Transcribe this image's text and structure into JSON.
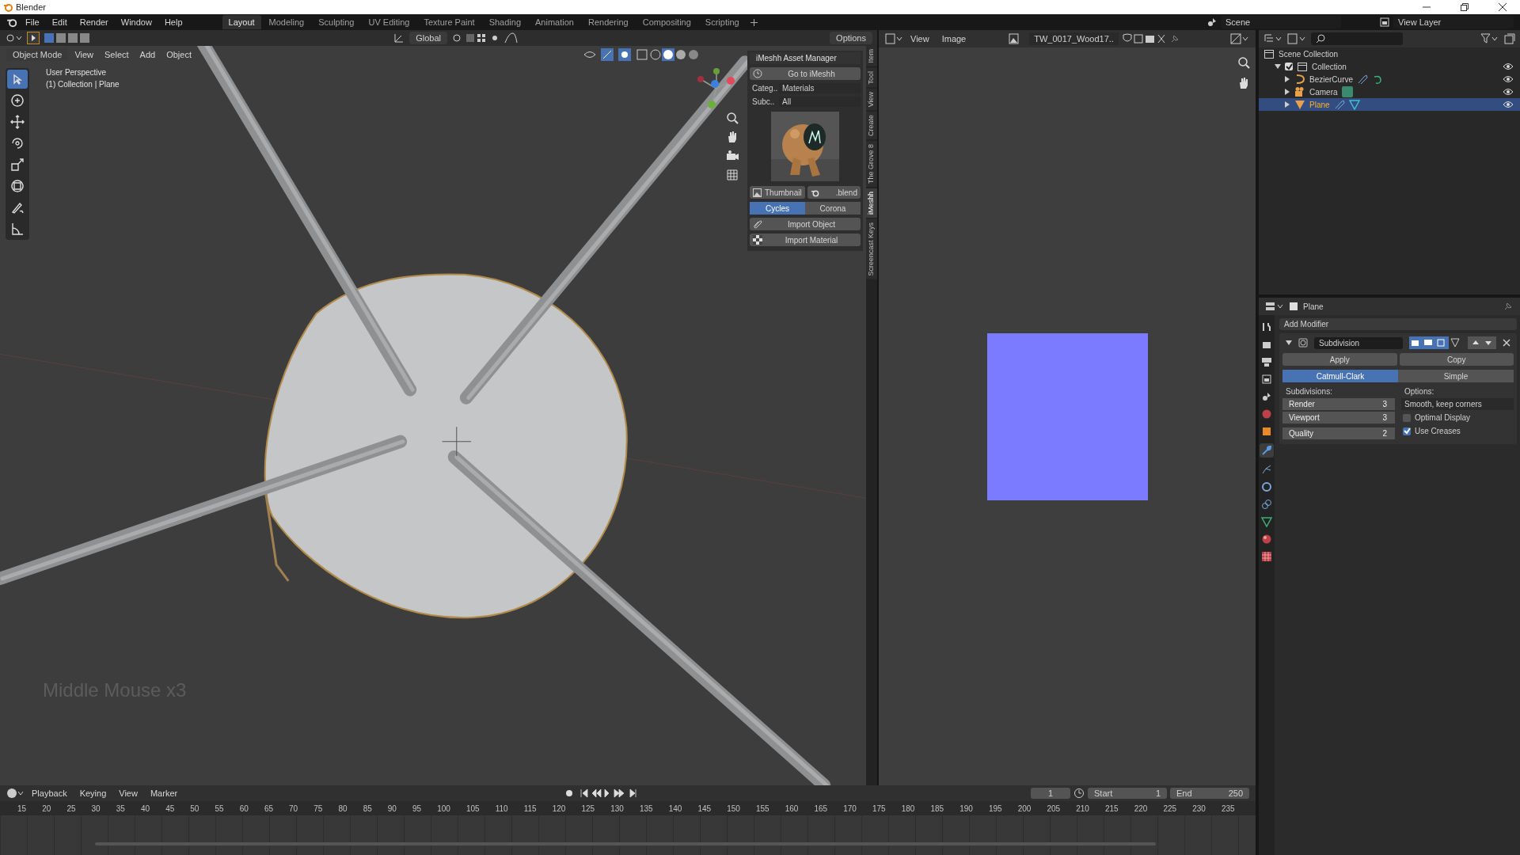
{
  "window": {
    "title": "Blender"
  },
  "menu": [
    "File",
    "Edit",
    "Render",
    "Window",
    "Help"
  ],
  "workspaces": [
    {
      "label": "Layout",
      "selected": true
    },
    {
      "label": "Modeling",
      "selected": false
    },
    {
      "label": "Sculpting",
      "selected": false
    },
    {
      "label": "UV Editing",
      "selected": false
    },
    {
      "label": "Texture Paint",
      "selected": false
    },
    {
      "label": "Shading",
      "selected": false
    },
    {
      "label": "Animation",
      "selected": false
    },
    {
      "label": "Rendering",
      "selected": false
    },
    {
      "label": "Compositing",
      "selected": false
    },
    {
      "label": "Scripting",
      "selected": false
    }
  ],
  "scene": "Scene",
  "view_layer": "View Layer",
  "tool_settings": {
    "orientation": "Global",
    "options": "Options"
  },
  "viewport": {
    "mode": "Object Mode",
    "menu": [
      "View",
      "Select",
      "Add",
      "Object"
    ],
    "info": [
      "User Perspective",
      "(1) Collection | Plane"
    ],
    "keys_overlay": "Middle Mouse x3",
    "tools": [
      {
        "kind": "select",
        "selected": true
      },
      {
        "kind": "cursor",
        "selected": false
      },
      {
        "kind": "move",
        "selected": false
      },
      {
        "kind": "rotate",
        "selected": false
      },
      {
        "kind": "scale",
        "selected": false
      },
      {
        "kind": "transform",
        "selected": false
      },
      {
        "kind": "annotate",
        "selected": false
      },
      {
        "kind": "measure",
        "selected": false
      }
    ]
  },
  "asset_panel": {
    "title": "iMeshh Asset Manager",
    "go_button": "Go to iMeshh",
    "category": {
      "label": "Categ..",
      "value": "Materials"
    },
    "subcategory": {
      "label": "Subc..",
      "value": "All"
    },
    "thumbnail_button": "Thumbnail",
    "blend_button": ".blend",
    "engines": [
      {
        "label": "Cycles",
        "selected": true
      },
      {
        "label": "Corona",
        "selected": false
      }
    ],
    "import_object": "Import Object",
    "import_material": "Import Material"
  },
  "side_tabs": [
    {
      "label": "Item",
      "selected": false
    },
    {
      "label": "Tool",
      "selected": false
    },
    {
      "label": "View",
      "selected": false
    },
    {
      "label": "Create",
      "selected": false
    },
    {
      "label": "The Grove 8",
      "selected": false
    },
    {
      "label": "iMeshh",
      "selected": true
    },
    {
      "label": "Screencast Keys",
      "selected": false
    }
  ],
  "image_editor": {
    "menu": [
      "View",
      "Image"
    ],
    "image_name": "TW_0017_Wood17.."
  },
  "outliner": {
    "root": "Scene Collection",
    "tree": [
      {
        "label": "Collection",
        "kind": "collection",
        "checked": true,
        "expanded": true,
        "selected": false,
        "children": [
          {
            "label": "BezierCurve",
            "kind": "curve",
            "expanded": false,
            "selected": false
          },
          {
            "label": "Camera",
            "kind": "camera",
            "expanded": false,
            "selected": false
          },
          {
            "label": "Plane",
            "kind": "mesh",
            "expanded": false,
            "selected": true
          }
        ]
      }
    ]
  },
  "properties": {
    "object": "Plane",
    "add_modifier": "Add Modifier",
    "modifier": {
      "name": "Subdivision",
      "expanded": true,
      "apply": "Apply",
      "copy": "Copy",
      "types": [
        {
          "label": "Catmull-Clark",
          "selected": true
        },
        {
          "label": "Simple",
          "selected": false
        }
      ],
      "subdivisions_label": "Subdivisions:",
      "fields": [
        {
          "label": "Render",
          "value": "3"
        },
        {
          "label": "Viewport",
          "value": "3"
        },
        {
          "label": "Quality",
          "value": "2"
        }
      ],
      "options_label": "Options:",
      "uv_smooth": "Smooth, keep corners",
      "checks": [
        {
          "label": "Optimal Display",
          "checked": false
        },
        {
          "label": "Use Creases",
          "checked": true
        }
      ]
    }
  },
  "timeline": {
    "menu": [
      "Playback",
      "Keying",
      "View",
      "Marker"
    ],
    "current_frame": "1",
    "start_label": "Start",
    "start": "1",
    "end_label": "End",
    "end": "250",
    "ticks": [
      "15",
      "20",
      "25",
      "30",
      "35",
      "40",
      "45",
      "50",
      "55",
      "60",
      "65",
      "70",
      "75",
      "80",
      "85",
      "90",
      "95",
      "100",
      "105",
      "110",
      "115",
      "120",
      "125",
      "130",
      "135",
      "140",
      "145",
      "150",
      "155",
      "160",
      "165",
      "170",
      "175",
      "180",
      "185",
      "190",
      "195",
      "200",
      "205",
      "210",
      "215",
      "220",
      "225",
      "230",
      "235"
    ]
  }
}
